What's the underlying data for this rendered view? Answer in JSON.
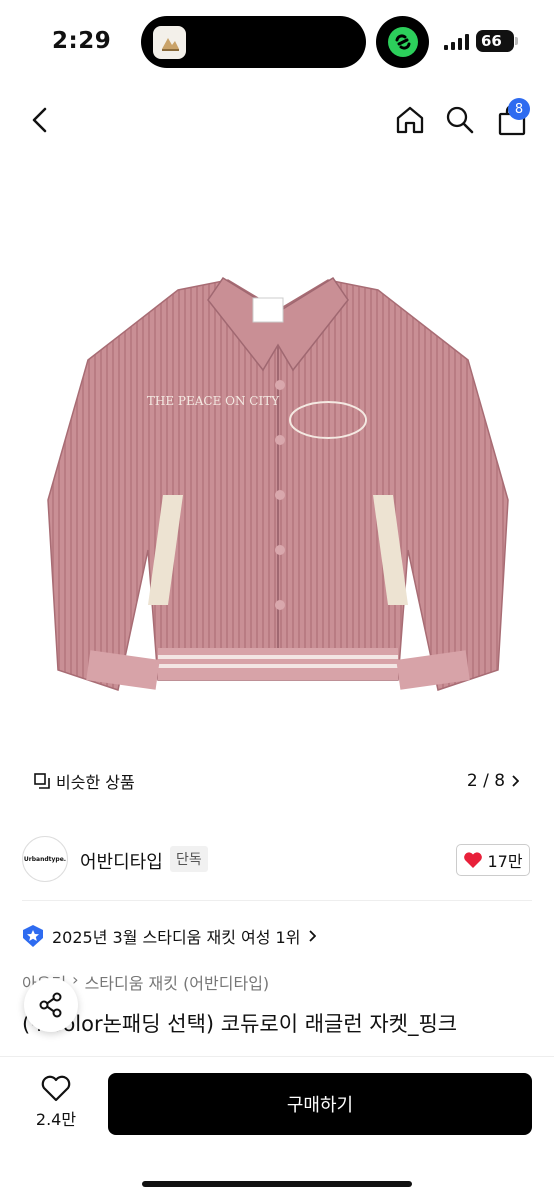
{
  "status": {
    "time": "2:29",
    "battery": "66"
  },
  "nav": {
    "cart_count": "8"
  },
  "gallery": {
    "similar_label": "비슷한 상품",
    "page_indicator": "2 / 8",
    "jacket_text": "THE PEACE ON CITY"
  },
  "brand": {
    "logo_text": "Urbandtype.",
    "name": "어반디타입",
    "tag": "단독",
    "likes": "17만"
  },
  "product": {
    "rank": "2025년 3월 스타디움 재킷 여성 1위",
    "breadcrumb": [
      "아우터",
      "스타디움 재킷 (어반디타입)"
    ],
    "title": "(+Color논패딩 선택) 코듀로이 래글런 자켓_핑크"
  },
  "bottom": {
    "wish_count": "2.4만",
    "buy_label": "구매하기"
  },
  "colors": {
    "accent": "#2e6bf0",
    "heart": "#e8203a",
    "jacket": "#c98f95"
  }
}
